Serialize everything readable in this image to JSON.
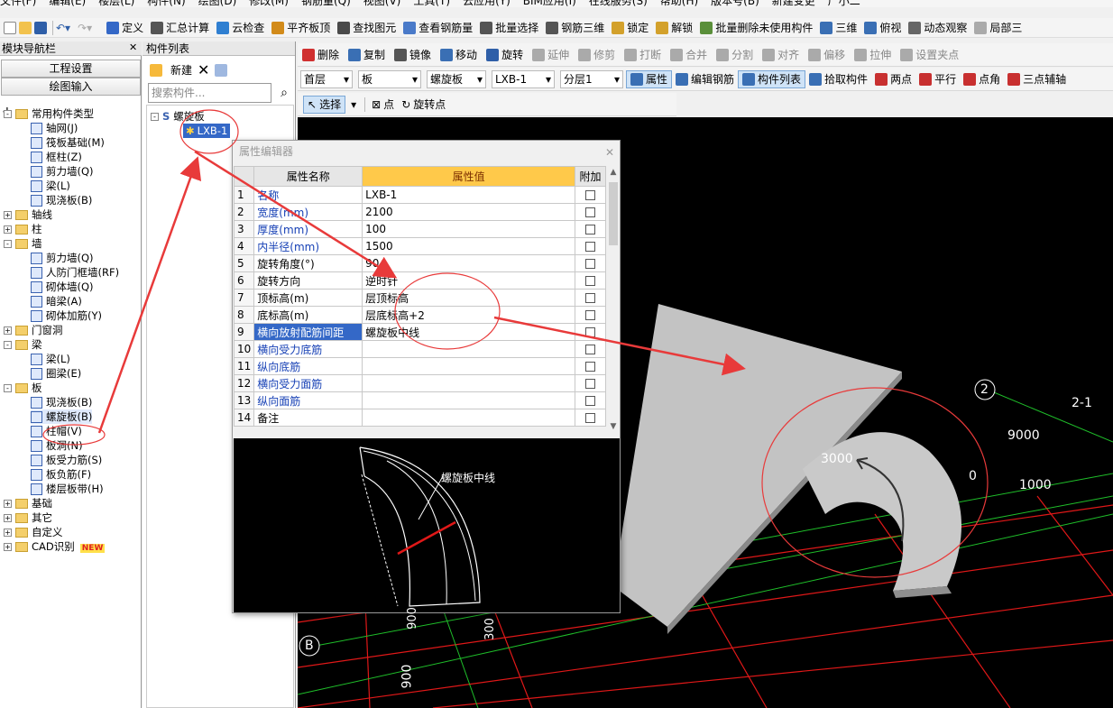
{
  "menu": [
    "文件(F)",
    "编辑(E)",
    "楼层(L)",
    "构件(N)",
    "绘图(D)",
    "修改(M)",
    "钢筋量(Q)",
    "视图(V)",
    "工具(T)",
    "云应用(Y)",
    "BIM应用(I)",
    "在线服务(S)",
    "帮助(H)",
    "版本号(B)",
    "新建变更",
    "广小二"
  ],
  "toolbar1": [
    "定义",
    "汇总计算",
    "云检查",
    "平齐板顶",
    "查找图元",
    "查看钢筋量",
    "批量选择",
    "钢筋三维",
    "锁定",
    "解锁",
    "批量删除未使用构件",
    "三维",
    "俯视",
    "动态观察",
    "局部三"
  ],
  "nav": {
    "title": "模块导航栏",
    "btn_settings": "工程设置",
    "btn_draw": "绘图输入",
    "tree": [
      {
        "label": "常用构件类型",
        "level": 0,
        "type": "folder",
        "exp": "-"
      },
      {
        "label": "轴网(J)",
        "level": 1,
        "type": "item"
      },
      {
        "label": "筏板基础(M)",
        "level": 1,
        "type": "item"
      },
      {
        "label": "框柱(Z)",
        "level": 1,
        "type": "item"
      },
      {
        "label": "剪力墙(Q)",
        "level": 1,
        "type": "item"
      },
      {
        "label": "梁(L)",
        "level": 1,
        "type": "item"
      },
      {
        "label": "现浇板(B)",
        "level": 1,
        "type": "item"
      },
      {
        "label": "轴线",
        "level": 0,
        "type": "folder",
        "exp": "+"
      },
      {
        "label": "柱",
        "level": 0,
        "type": "folder",
        "exp": "+"
      },
      {
        "label": "墙",
        "level": 0,
        "type": "folder",
        "exp": "-"
      },
      {
        "label": "剪力墙(Q)",
        "level": 1,
        "type": "item"
      },
      {
        "label": "人防门框墙(RF)",
        "level": 1,
        "type": "item"
      },
      {
        "label": "砌体墙(Q)",
        "level": 1,
        "type": "item"
      },
      {
        "label": "暗梁(A)",
        "level": 1,
        "type": "item"
      },
      {
        "label": "砌体加筋(Y)",
        "level": 1,
        "type": "item"
      },
      {
        "label": "门窗洞",
        "level": 0,
        "type": "folder",
        "exp": "+"
      },
      {
        "label": "梁",
        "level": 0,
        "type": "folder",
        "exp": "-"
      },
      {
        "label": "梁(L)",
        "level": 1,
        "type": "item"
      },
      {
        "label": "圈梁(E)",
        "level": 1,
        "type": "item"
      },
      {
        "label": "板",
        "level": 0,
        "type": "folder",
        "exp": "-"
      },
      {
        "label": "现浇板(B)",
        "level": 1,
        "type": "item"
      },
      {
        "label": "螺旋板(B)",
        "level": 1,
        "type": "item"
      },
      {
        "label": "柱帽(V)",
        "level": 1,
        "type": "item"
      },
      {
        "label": "板洞(N)",
        "level": 1,
        "type": "item"
      },
      {
        "label": "板受力筋(S)",
        "level": 1,
        "type": "item"
      },
      {
        "label": "板负筋(F)",
        "level": 1,
        "type": "item"
      },
      {
        "label": "楼层板带(H)",
        "level": 1,
        "type": "item"
      },
      {
        "label": "基础",
        "level": 0,
        "type": "folder",
        "exp": "+"
      },
      {
        "label": "其它",
        "level": 0,
        "type": "folder",
        "exp": "+"
      },
      {
        "label": "自定义",
        "level": 0,
        "type": "folder",
        "exp": "+"
      },
      {
        "label": "CAD识别",
        "level": 0,
        "type": "folder",
        "exp": "+"
      }
    ],
    "new_badge": "NEW"
  },
  "complist": {
    "title": "构件列表",
    "new_btn": "新建",
    "search_placeholder": "搜索构件...",
    "root": "螺旋板",
    "child": "LXB-1"
  },
  "toolbar2": [
    "删除",
    "复制",
    "镜像",
    "移动",
    "旋转",
    "延伸",
    "修剪",
    "打断",
    "合并",
    "分割",
    "对齐",
    "偏移",
    "拉伸",
    "设置夹点"
  ],
  "toolbar3": {
    "floor": "首层",
    "type": "板",
    "subtype": "螺旋板",
    "comp": "LXB-1",
    "layer": "分层1",
    "btns": [
      "属性",
      "编辑钢筋",
      "构件列表",
      "拾取构件",
      "两点",
      "平行",
      "点角",
      "三点辅轴"
    ]
  },
  "toolbar4": [
    "选择",
    "点",
    "旋转点"
  ],
  "editor": {
    "title": "属性编辑器",
    "col_name": "属性名称",
    "col_value": "属性值",
    "col_add": "附加",
    "rows": [
      {
        "n": "1",
        "k": "名称",
        "v": "LXB-1",
        "blue": true
      },
      {
        "n": "2",
        "k": "宽度(mm)",
        "v": "2100",
        "blue": true
      },
      {
        "n": "3",
        "k": "厚度(mm)",
        "v": "100",
        "blue": true
      },
      {
        "n": "4",
        "k": "内半径(mm)",
        "v": "1500",
        "blue": true
      },
      {
        "n": "5",
        "k": "旋转角度(°)",
        "v": "90",
        "blue": false
      },
      {
        "n": "6",
        "k": "旋转方向",
        "v": "逆时针",
        "blue": false
      },
      {
        "n": "7",
        "k": "顶标高(m)",
        "v": "层顶标高",
        "blue": false
      },
      {
        "n": "8",
        "k": "底标高(m)",
        "v": "层底标高+2",
        "blue": false
      },
      {
        "n": "9",
        "k": "横向放射配筋间距",
        "v": "螺旋板中线",
        "blue": false,
        "hl": true
      },
      {
        "n": "10",
        "k": "横向受力底筋",
        "v": "",
        "blue": true
      },
      {
        "n": "11",
        "k": "纵向底筋",
        "v": "",
        "blue": true
      },
      {
        "n": "12",
        "k": "横向受力面筋",
        "v": "",
        "blue": true
      },
      {
        "n": "13",
        "k": "纵向面筋",
        "v": "",
        "blue": true
      },
      {
        "n": "14",
        "k": "备注",
        "v": "",
        "blue": false
      }
    ],
    "preview_label": "螺旋板中线",
    "preview_dims": [
      "900",
      "300"
    ]
  },
  "canvas": {
    "axis_labels": [
      "2",
      "2-1",
      "B"
    ],
    "dims": [
      "9000",
      "3000",
      "1000",
      "0"
    ]
  },
  "colors": {
    "accent": "#3468c7",
    "header": "#ffc94a",
    "arrow": "#e83a3a",
    "plate": "#c0c0c0"
  }
}
